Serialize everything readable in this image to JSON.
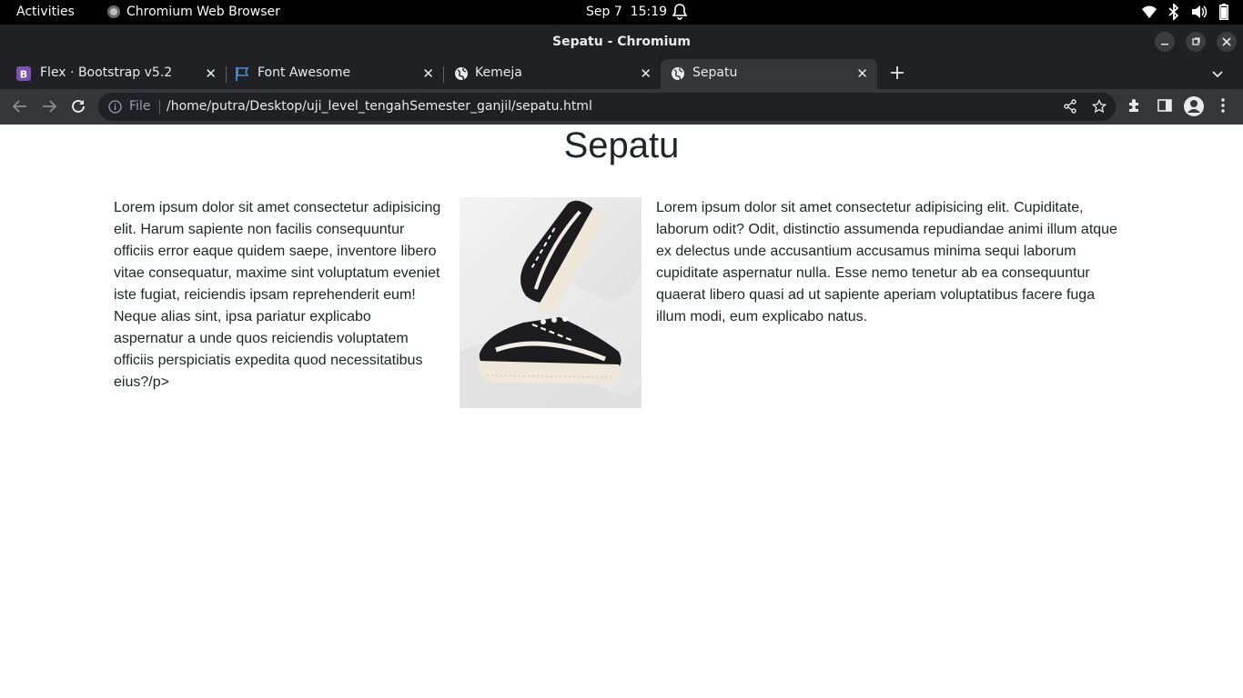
{
  "system": {
    "activities_label": "Activities",
    "app_name": "Chromium Web Browser",
    "date": "Sep 7",
    "time": "15:19"
  },
  "window": {
    "title": "Sepatu - Chromium"
  },
  "tabs": [
    {
      "label": "Flex · Bootstrap v5.2",
      "icon": "bootstrap-icon",
      "active": false
    },
    {
      "label": "Font Awesome",
      "icon": "flag-icon",
      "active": false
    },
    {
      "label": "Kemeja",
      "icon": "globe-icon",
      "active": false
    },
    {
      "label": "Sepatu",
      "icon": "globe-icon",
      "active": true
    }
  ],
  "toolbar": {
    "scheme_label": "File",
    "url": "/home/putra/Desktop/uji_level_tengahSemester_ganjil/sepatu.html"
  },
  "page": {
    "title": "Sepatu",
    "left_text": "Lorem ipsum dolor sit amet consectetur adipisicing elit. Harum sapiente non facilis consequuntur officiis error eaque quidem saepe, inventore libero vitae consequatur, maxime sint voluptatum eveniet iste fugiat, reiciendis ipsam reprehenderit eum! Neque alias sint, ipsa pariatur explicabo aspernatur a unde quos reiciendis voluptatem officiis perspiciatis expedita quod necessitatibus eius?/p>",
    "right_text": "Lorem ipsum dolor sit amet consectetur adipisicing elit. Cupiditate, laborum odit? Odit, distinctio assumenda repudiandae animi illum atque ex delectus unde accusantium accusamus minima sequi laborum cupiditate aspernatur nulla. Esse nemo tenetur ab ea consequuntur quaerat libero quasi ad ut sapiente aperiam voluptatibus facere fuga illum modi, eum explicabo natus."
  },
  "colors": {
    "bootstrap_purple": "#7952b3",
    "font_awesome_blue": "#528dd7",
    "text": "#212529"
  }
}
